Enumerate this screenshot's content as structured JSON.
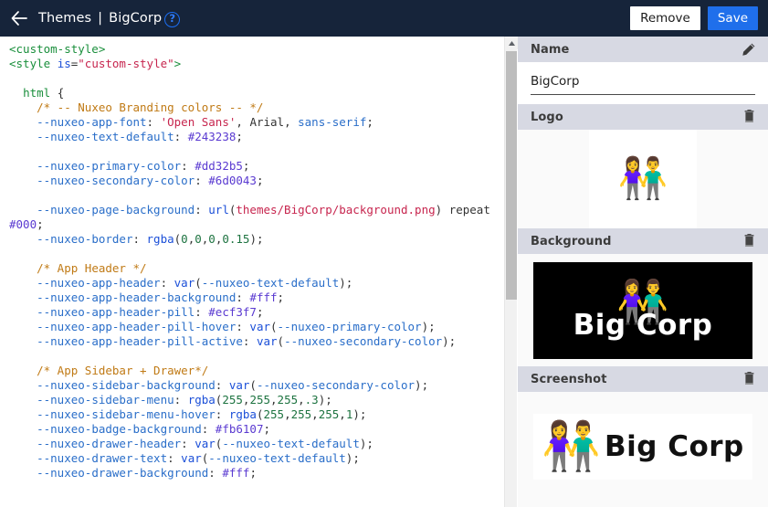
{
  "topbar": {
    "back_icon": "back-arrow-icon",
    "breadcrumb_root": "Themes",
    "breadcrumb_separator": "|",
    "breadcrumb_current": "BigCorp",
    "help_icon_label": "?",
    "remove_label": "Remove",
    "save_label": "Save",
    "background_color": "#16243a",
    "save_color": "#1f6feb"
  },
  "editor": {
    "language": "css",
    "lines": [
      [
        {
          "t": "<custom-style>",
          "c": "tag"
        }
      ],
      [
        {
          "t": "<style ",
          "c": "tag"
        },
        {
          "t": "is",
          "c": "attr"
        },
        {
          "t": "=",
          "c": "punc"
        },
        {
          "t": "\"custom-style\"",
          "c": "str"
        },
        {
          "t": ">",
          "c": "tag"
        }
      ],
      [],
      [
        {
          "t": "  ",
          "c": "plain"
        },
        {
          "t": "html",
          "c": "tag"
        },
        {
          "t": " {",
          "c": "punc"
        }
      ],
      [
        {
          "t": "    ",
          "c": "plain"
        },
        {
          "t": "/* -- Nuxeo Branding colors -- */",
          "c": "comment"
        }
      ],
      [
        {
          "t": "    ",
          "c": "plain"
        },
        {
          "t": "--nuxeo-app-font",
          "c": "prop"
        },
        {
          "t": ": ",
          "c": "punc"
        },
        {
          "t": "'Open Sans'",
          "c": "str"
        },
        {
          "t": ", Arial, ",
          "c": "plain"
        },
        {
          "t": "sans-serif",
          "c": "prop"
        },
        {
          "t": ";",
          "c": "punc"
        }
      ],
      [
        {
          "t": "    ",
          "c": "plain"
        },
        {
          "t": "--nuxeo-text-default",
          "c": "prop"
        },
        {
          "t": ": ",
          "c": "punc"
        },
        {
          "t": "#243238",
          "c": "hex"
        },
        {
          "t": ";",
          "c": "punc"
        }
      ],
      [],
      [
        {
          "t": "    ",
          "c": "plain"
        },
        {
          "t": "--nuxeo-primary-color",
          "c": "prop"
        },
        {
          "t": ": ",
          "c": "punc"
        },
        {
          "t": "#dd32b5",
          "c": "hex"
        },
        {
          "t": ";",
          "c": "punc"
        }
      ],
      [
        {
          "t": "    ",
          "c": "plain"
        },
        {
          "t": "--nuxeo-secondary-color",
          "c": "prop"
        },
        {
          "t": ": ",
          "c": "punc"
        },
        {
          "t": "#6d0043",
          "c": "hex"
        },
        {
          "t": ";",
          "c": "punc"
        }
      ],
      [],
      [
        {
          "t": "    ",
          "c": "plain"
        },
        {
          "t": "--nuxeo-page-background",
          "c": "prop"
        },
        {
          "t": ": ",
          "c": "punc"
        },
        {
          "t": "url",
          "c": "fn"
        },
        {
          "t": "(",
          "c": "punc"
        },
        {
          "t": "themes/BigCorp/background.png",
          "c": "str"
        },
        {
          "t": ") ",
          "c": "punc"
        },
        {
          "t": "repeat ",
          "c": "plain"
        },
        {
          "t": "#000",
          "c": "hex"
        },
        {
          "t": ";",
          "c": "punc"
        }
      ],
      [
        {
          "t": "    ",
          "c": "plain"
        },
        {
          "t": "--nuxeo-border",
          "c": "prop"
        },
        {
          "t": ": ",
          "c": "punc"
        },
        {
          "t": "rgba",
          "c": "fn"
        },
        {
          "t": "(",
          "c": "punc"
        },
        {
          "t": "0",
          "c": "num"
        },
        {
          "t": ",",
          "c": "punc"
        },
        {
          "t": "0",
          "c": "num"
        },
        {
          "t": ",",
          "c": "punc"
        },
        {
          "t": "0",
          "c": "num"
        },
        {
          "t": ",",
          "c": "punc"
        },
        {
          "t": "0.15",
          "c": "num"
        },
        {
          "t": ");",
          "c": "punc"
        }
      ],
      [],
      [
        {
          "t": "    ",
          "c": "plain"
        },
        {
          "t": "/* App Header */",
          "c": "comment"
        }
      ],
      [
        {
          "t": "    ",
          "c": "plain"
        },
        {
          "t": "--nuxeo-app-header",
          "c": "prop"
        },
        {
          "t": ": ",
          "c": "punc"
        },
        {
          "t": "var",
          "c": "fn"
        },
        {
          "t": "(",
          "c": "punc"
        },
        {
          "t": "--nuxeo-text-default",
          "c": "prop"
        },
        {
          "t": ");",
          "c": "punc"
        }
      ],
      [
        {
          "t": "    ",
          "c": "plain"
        },
        {
          "t": "--nuxeo-app-header-background",
          "c": "prop"
        },
        {
          "t": ": ",
          "c": "punc"
        },
        {
          "t": "#fff",
          "c": "hex"
        },
        {
          "t": ";",
          "c": "punc"
        }
      ],
      [
        {
          "t": "    ",
          "c": "plain"
        },
        {
          "t": "--nuxeo-app-header-pill",
          "c": "prop"
        },
        {
          "t": ": ",
          "c": "punc"
        },
        {
          "t": "#ecf3f7",
          "c": "hex"
        },
        {
          "t": ";",
          "c": "punc"
        }
      ],
      [
        {
          "t": "    ",
          "c": "plain"
        },
        {
          "t": "--nuxeo-app-header-pill-hover",
          "c": "prop"
        },
        {
          "t": ": ",
          "c": "punc"
        },
        {
          "t": "var",
          "c": "fn"
        },
        {
          "t": "(",
          "c": "punc"
        },
        {
          "t": "--nuxeo-primary-color",
          "c": "prop"
        },
        {
          "t": ");",
          "c": "punc"
        }
      ],
      [
        {
          "t": "    ",
          "c": "plain"
        },
        {
          "t": "--nuxeo-app-header-pill-active",
          "c": "prop"
        },
        {
          "t": ": ",
          "c": "punc"
        },
        {
          "t": "var",
          "c": "fn"
        },
        {
          "t": "(",
          "c": "punc"
        },
        {
          "t": "--nuxeo-secondary-color",
          "c": "prop"
        },
        {
          "t": ");",
          "c": "punc"
        }
      ],
      [],
      [
        {
          "t": "    ",
          "c": "plain"
        },
        {
          "t": "/* App Sidebar + Drawer*/",
          "c": "comment"
        }
      ],
      [
        {
          "t": "    ",
          "c": "plain"
        },
        {
          "t": "--nuxeo-sidebar-background",
          "c": "prop"
        },
        {
          "t": ": ",
          "c": "punc"
        },
        {
          "t": "var",
          "c": "fn"
        },
        {
          "t": "(",
          "c": "punc"
        },
        {
          "t": "--nuxeo-secondary-color",
          "c": "prop"
        },
        {
          "t": ");",
          "c": "punc"
        }
      ],
      [
        {
          "t": "    ",
          "c": "plain"
        },
        {
          "t": "--nuxeo-sidebar-menu",
          "c": "prop"
        },
        {
          "t": ": ",
          "c": "punc"
        },
        {
          "t": "rgba",
          "c": "fn"
        },
        {
          "t": "(",
          "c": "punc"
        },
        {
          "t": "255",
          "c": "num"
        },
        {
          "t": ",",
          "c": "punc"
        },
        {
          "t": "255",
          "c": "num"
        },
        {
          "t": ",",
          "c": "punc"
        },
        {
          "t": "255",
          "c": "num"
        },
        {
          "t": ",",
          "c": "punc"
        },
        {
          "t": ".3",
          "c": "num"
        },
        {
          "t": ");",
          "c": "punc"
        }
      ],
      [
        {
          "t": "    ",
          "c": "plain"
        },
        {
          "t": "--nuxeo-sidebar-menu-hover",
          "c": "prop"
        },
        {
          "t": ": ",
          "c": "punc"
        },
        {
          "t": "rgba",
          "c": "fn"
        },
        {
          "t": "(",
          "c": "punc"
        },
        {
          "t": "255",
          "c": "num"
        },
        {
          "t": ",",
          "c": "punc"
        },
        {
          "t": "255",
          "c": "num"
        },
        {
          "t": ",",
          "c": "punc"
        },
        {
          "t": "255",
          "c": "num"
        },
        {
          "t": ",",
          "c": "punc"
        },
        {
          "t": "1",
          "c": "num"
        },
        {
          "t": ");",
          "c": "punc"
        }
      ],
      [
        {
          "t": "    ",
          "c": "plain"
        },
        {
          "t": "--nuxeo-badge-background",
          "c": "prop"
        },
        {
          "t": ": ",
          "c": "punc"
        },
        {
          "t": "#fb6107",
          "c": "hex"
        },
        {
          "t": ";",
          "c": "punc"
        }
      ],
      [
        {
          "t": "    ",
          "c": "plain"
        },
        {
          "t": "--nuxeo-drawer-header",
          "c": "prop"
        },
        {
          "t": ": ",
          "c": "punc"
        },
        {
          "t": "var",
          "c": "fn"
        },
        {
          "t": "(",
          "c": "punc"
        },
        {
          "t": "--nuxeo-text-default",
          "c": "prop"
        },
        {
          "t": ");",
          "c": "punc"
        }
      ],
      [
        {
          "t": "    ",
          "c": "plain"
        },
        {
          "t": "--nuxeo-drawer-text",
          "c": "prop"
        },
        {
          "t": ": ",
          "c": "punc"
        },
        {
          "t": "var",
          "c": "fn"
        },
        {
          "t": "(",
          "c": "punc"
        },
        {
          "t": "--nuxeo-text-default",
          "c": "prop"
        },
        {
          "t": ");",
          "c": "punc"
        }
      ],
      [
        {
          "t": "    ",
          "c": "plain"
        },
        {
          "t": "--nuxeo-drawer-background",
          "c": "prop"
        },
        {
          "t": ": ",
          "c": "punc"
        },
        {
          "t": "#fff",
          "c": "hex"
        },
        {
          "t": ";",
          "c": "punc"
        }
      ]
    ]
  },
  "scrollbar": {
    "up_arrow_icon": "scroll-up-arrow-icon",
    "thumb_position": "top"
  },
  "panel": {
    "name_section": {
      "title": "Name",
      "action_icon": "pencil-edit-icon",
      "value": "BigCorp",
      "placeholder": "Name"
    },
    "logo_section": {
      "title": "Logo",
      "action_icon": "trash-delete-icon",
      "image_alt": "couple-emoji",
      "emoji": "👫"
    },
    "background_section": {
      "title": "Background",
      "action_icon": "trash-delete-icon",
      "image_alt": "big-corp-background",
      "emoji": "👫",
      "wordmark": "Big Corp",
      "image_background": "#000000"
    },
    "screenshot_section": {
      "title": "Screenshot",
      "action_icon": "trash-delete-icon",
      "image_alt": "big-corp-screenshot",
      "emoji": "👫",
      "wordmark": "Big Corp",
      "image_background": "#ffffff"
    }
  }
}
